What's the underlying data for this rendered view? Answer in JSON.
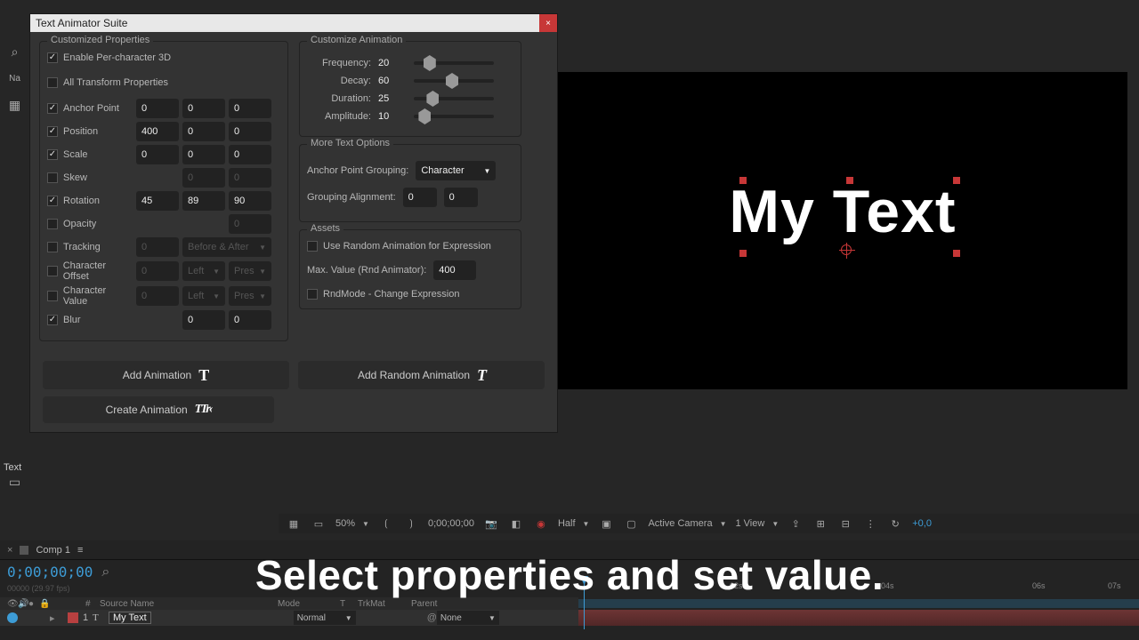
{
  "dialog": {
    "title": "Text Animator Suite",
    "sections": {
      "custom_props": "Customized Properties",
      "custom_anim": "Customize Animation",
      "more_text": "More Text Options",
      "assets": "Assets"
    },
    "enable3d": "Enable Per-character 3D",
    "all_transform": "All Transform Properties",
    "props": {
      "anchor": {
        "label": "Anchor Point",
        "x": "0",
        "y": "0",
        "z": "0"
      },
      "position": {
        "label": "Position",
        "x": "400",
        "y": "0",
        "z": "0"
      },
      "scale": {
        "label": "Scale",
        "x": "0",
        "y": "0",
        "z": "0"
      },
      "skew": {
        "label": "Skew",
        "y": "0",
        "z": "0"
      },
      "rotation": {
        "label": "Rotation",
        "x": "45",
        "y": "89",
        "z": "90"
      },
      "opacity": {
        "label": "Opacity",
        "z": "0"
      },
      "tracking": {
        "label": "Tracking",
        "x": "0",
        "drop": "Before & After"
      },
      "charoffset": {
        "label": "Character Offset",
        "x": "0",
        "d1": "Left",
        "d2": "Pres"
      },
      "charvalue": {
        "label": "Character Value",
        "x": "0",
        "d1": "Left",
        "d2": "Pres"
      },
      "blur": {
        "label": "Blur",
        "y": "0",
        "z": "0"
      }
    },
    "anim": {
      "frequency": {
        "label": "Frequency:",
        "val": "20",
        "pct": 12
      },
      "decay": {
        "label": "Decay:",
        "val": "60",
        "pct": 40
      },
      "duration": {
        "label": "Duration:",
        "val": "25",
        "pct": 16
      },
      "amplitude": {
        "label": "Amplitude:",
        "val": "10",
        "pct": 6
      }
    },
    "more": {
      "anchor_group_label": "Anchor Point Grouping:",
      "anchor_group_val": "Character",
      "group_align_label": "Grouping Alignment:",
      "ga_x": "0",
      "ga_y": "0"
    },
    "assets_s": {
      "rnd_expr": "Use Random Animation for Expression",
      "max_label": "Max. Value (Rnd Animator):",
      "max_val": "400",
      "rnd_mode": "RndMode - Change Expression"
    },
    "buttons": {
      "add": "Add Animation",
      "add_rnd": "Add Random Animation",
      "create": "Create Animation"
    }
  },
  "left_rail": {
    "na": "Na",
    "text_label": "Text"
  },
  "preview": {
    "text": "My Text"
  },
  "viewer_bar": {
    "zoom": "50%",
    "timecode": "0;00;00;00",
    "res": "Half",
    "camera": "Active Camera",
    "view": "1 View",
    "offset": "+0,0"
  },
  "timeline": {
    "tab": "Comp 1",
    "timecode": "0;00;00;00",
    "meta": "00000 (29.97 fps)",
    "cols": {
      "num": "#",
      "src": "Source Name",
      "mode": "Mode",
      "t": "T",
      "trk": "TrkMat",
      "parent": "Parent"
    },
    "layer": {
      "num": "1",
      "name": "My Text",
      "mode": "Normal",
      "parent": "None"
    },
    "marks": [
      "02s",
      "04s",
      "06s",
      "07s"
    ]
  },
  "caption": "Select properties and set value."
}
